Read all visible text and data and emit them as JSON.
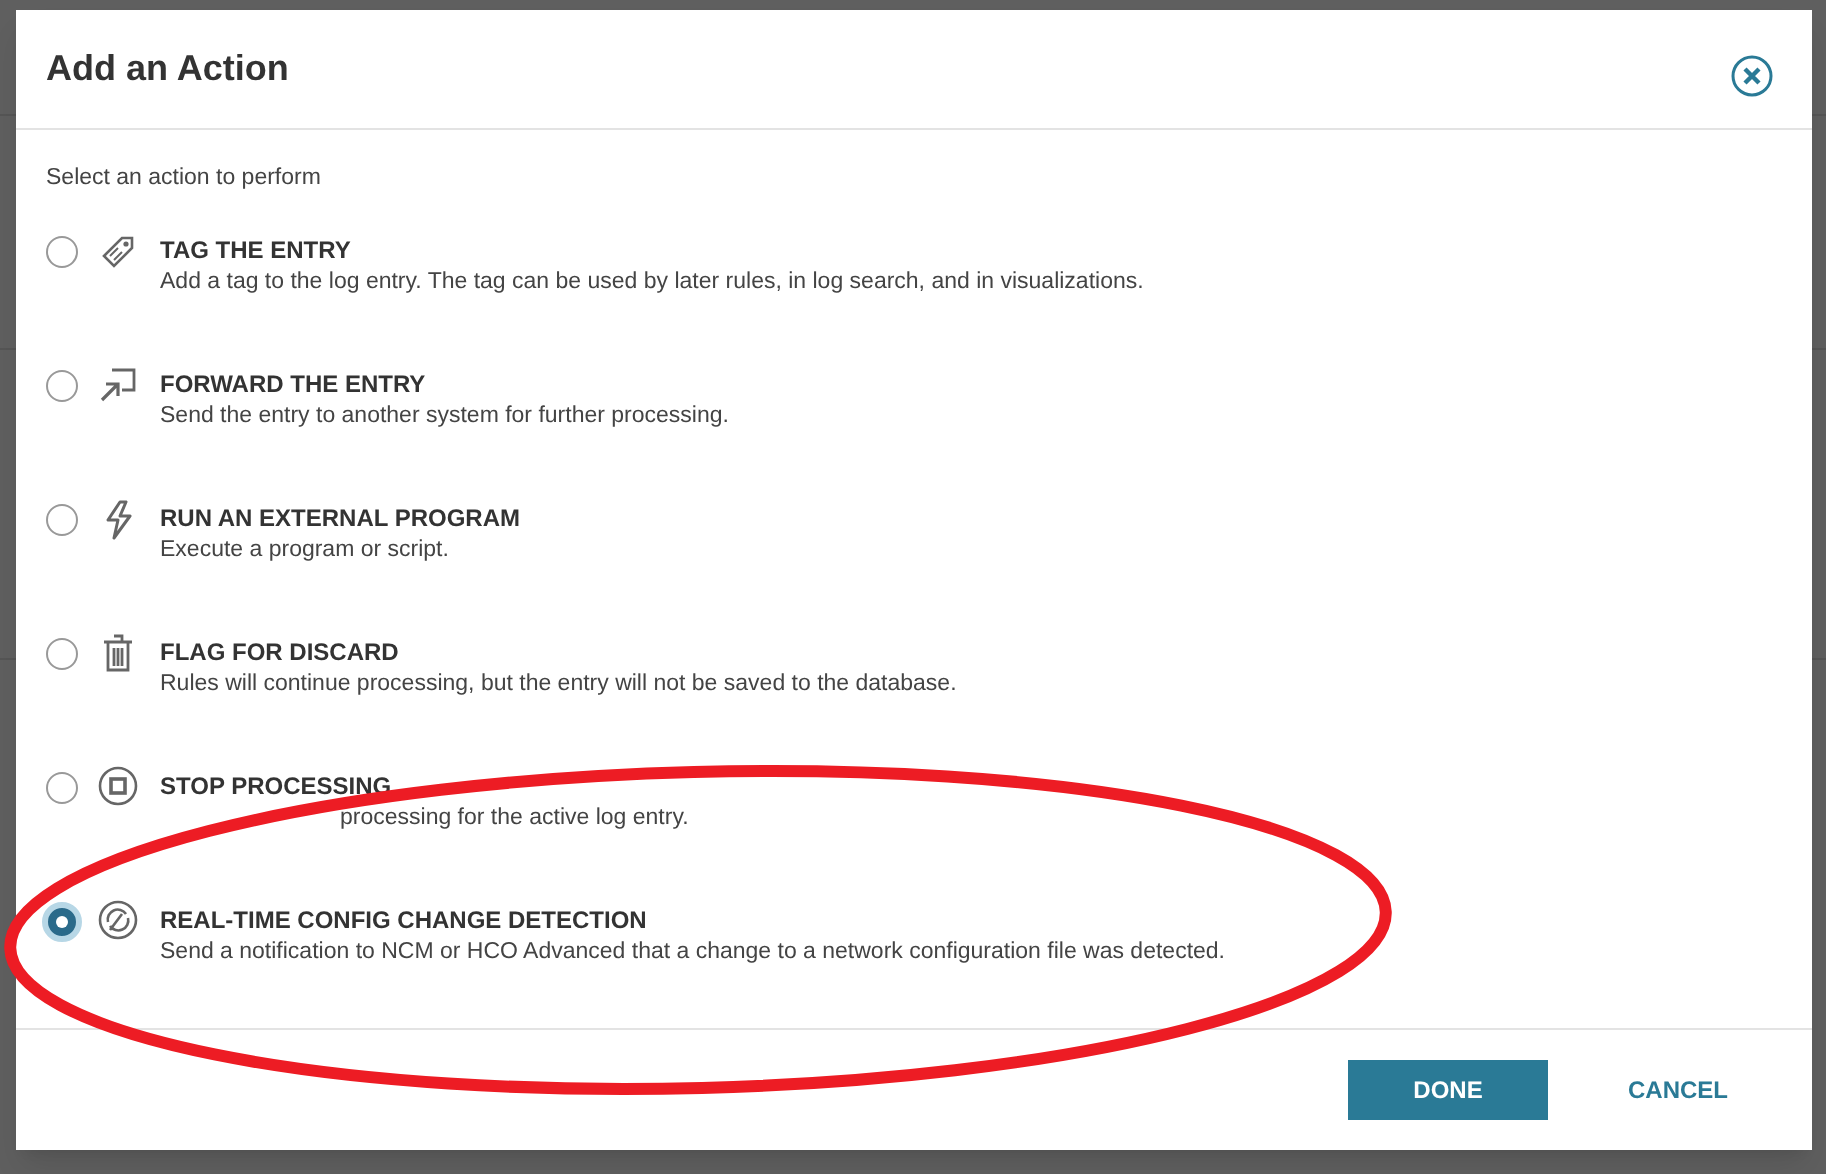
{
  "dialog": {
    "title": "Add an Action",
    "prompt": "Select an action to perform",
    "actions": [
      {
        "kind": "tag",
        "title": "TAG THE ENTRY",
        "description": "Add a tag to the log entry. The tag can be used by later rules, in log search, and in visualizations.",
        "selected": false
      },
      {
        "kind": "forward",
        "title": "FORWARD THE ENTRY",
        "description": "Send the entry to another system for further processing.",
        "selected": false
      },
      {
        "kind": "program",
        "title": "RUN AN EXTERNAL PROGRAM",
        "description": "Execute a program or script.",
        "selected": false
      },
      {
        "kind": "discard",
        "title": "FLAG FOR DISCARD",
        "description": "Rules will continue processing, but the entry will not be saved to the database.",
        "selected": false
      },
      {
        "kind": "stop",
        "title": "STOP PROCESSING",
        "description": "processing for the active log entry.",
        "covered_start": true,
        "selected": false
      },
      {
        "kind": "config",
        "title": "REAL-TIME CONFIG CHANGE DETECTION",
        "description": "Send a notification to NCM or HCO Advanced that a change to a network configuration file was detected.",
        "selected": true
      }
    ],
    "buttons": [
      {
        "kind": "primary",
        "label": "DONE"
      },
      {
        "kind": "secondary",
        "label": "CANCEL"
      }
    ]
  }
}
